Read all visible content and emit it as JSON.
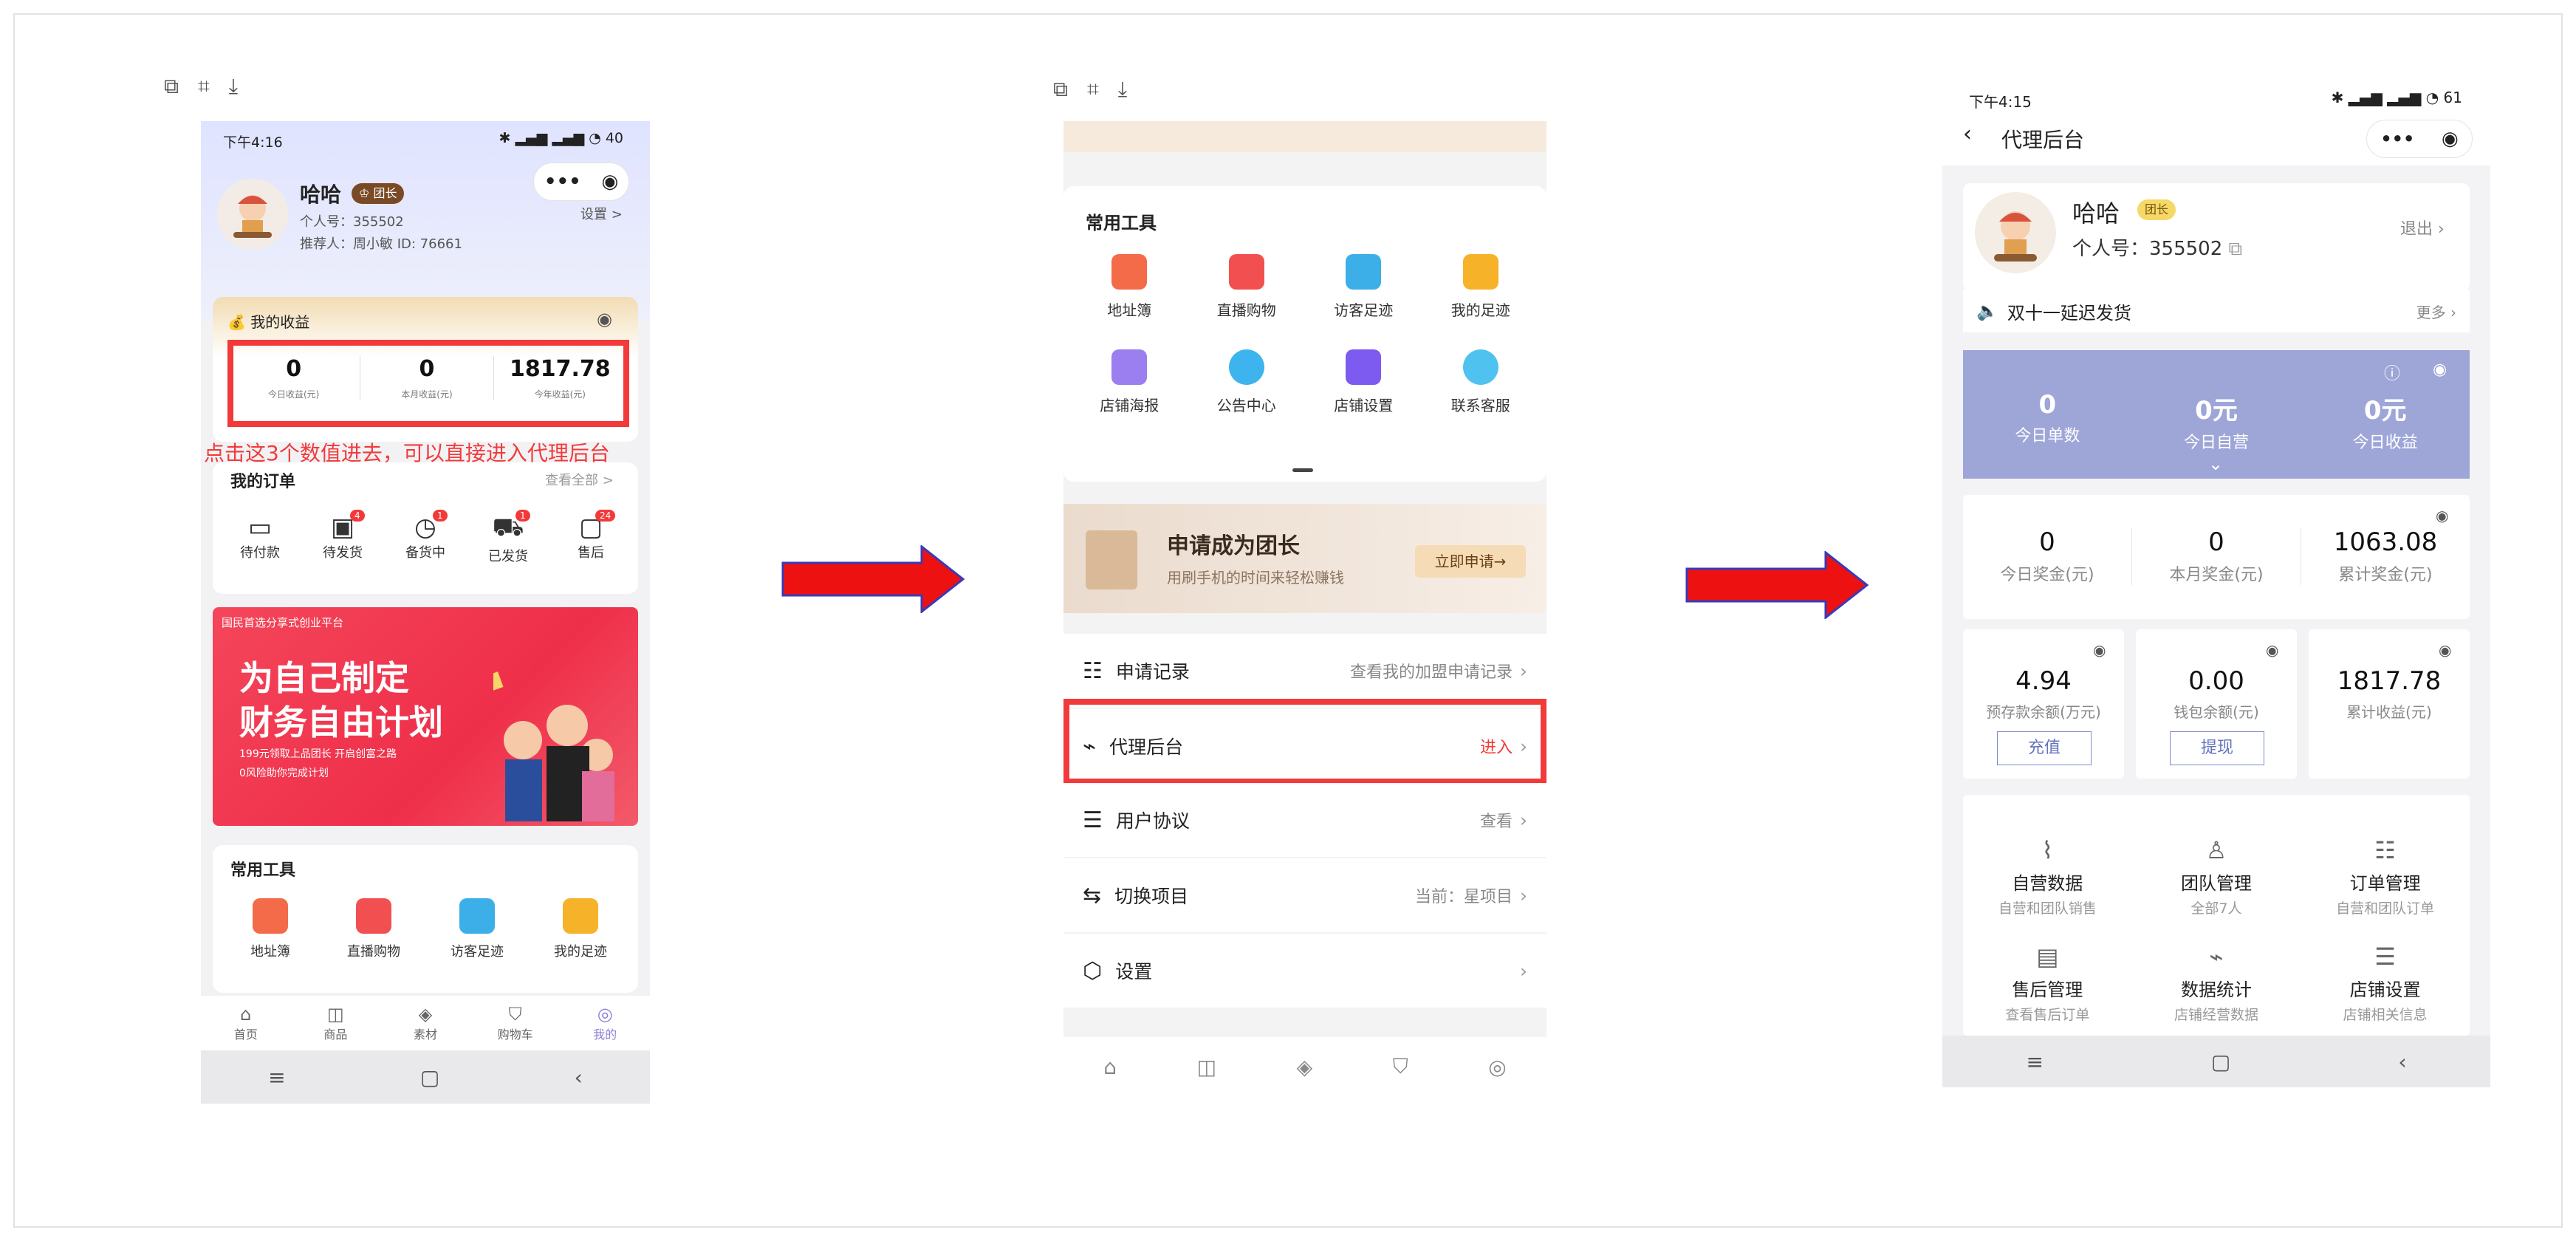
{
  "screen1": {
    "status_time": "下午4:16",
    "status_battery": "40",
    "user_name": "哈哈",
    "role_badge": "团长",
    "personal_id": "个人号：355502",
    "referrer": "推荐人：周小敏  ID: 76661",
    "settings_label": "设置 >",
    "earnings_title": "我的收益",
    "earnings": [
      {
        "value": "0",
        "label": "今日收益(元)"
      },
      {
        "value": "0",
        "label": "本月收益(元)"
      },
      {
        "value": "1817.78",
        "label": "今年收益(元)"
      }
    ],
    "annotation": "点击这3个数值进去，可以直接进入代理后台",
    "orders_title": "我的订单",
    "orders_view_all": "查看全部 >",
    "order_items": [
      {
        "label": "待付款",
        "badge": ""
      },
      {
        "label": "待发货",
        "badge": "4"
      },
      {
        "label": "备货中",
        "badge": "1"
      },
      {
        "label": "已发货",
        "badge": "1"
      },
      {
        "label": "售后",
        "badge": "24"
      }
    ],
    "banner_top": "国民首选分享式创业平台",
    "banner_line1": "为自己制定",
    "banner_line2": "财务自由计划",
    "banner_sub1": "199元领取上品团长 开启创富之路",
    "banner_sub2": "0风险助你完成计划",
    "tools_title": "常用工具",
    "tools": [
      "地址簿",
      "直播购物",
      "访客足迹",
      "我的足迹"
    ],
    "tabbar": [
      "首页",
      "商品",
      "素材",
      "购物车",
      "我的"
    ]
  },
  "screen2": {
    "tools_title": "常用工具",
    "tools": [
      "地址簿",
      "直播购物",
      "访客足迹",
      "我的足迹",
      "店铺海报",
      "公告中心",
      "店铺设置",
      "联系客服"
    ],
    "apply_title": "申请成为团长",
    "apply_sub": "用刷手机的时间来轻松赚钱",
    "apply_button": "立即申请→",
    "menu": [
      {
        "label": "申请记录",
        "right": "查看我的加盟申请记录"
      },
      {
        "label": "代理后台",
        "right": "进入"
      },
      {
        "label": "用户协议",
        "right": "查看"
      },
      {
        "label": "切换项目",
        "right": "当前：星项目"
      },
      {
        "label": "设置",
        "right": ""
      }
    ]
  },
  "screen3": {
    "status_time": "下午4:15",
    "status_battery": "61",
    "page_title": "代理后台",
    "user_name": "哈哈",
    "role_badge": "团长",
    "personal_id": "个人号：355502",
    "logout": "退出",
    "notice": "双十一延迟发货",
    "notice_more": "更多",
    "today_stats": [
      {
        "value": "0",
        "label": "今日单数"
      },
      {
        "value": "0元",
        "label": "今日自营"
      },
      {
        "value": "0元",
        "label": "今日收益"
      }
    ],
    "bonus_stats": [
      {
        "value": "0",
        "label": "今日奖金(元)"
      },
      {
        "value": "0",
        "label": "本月奖金(元)"
      },
      {
        "value": "1063.08",
        "label": "累计奖金(元)"
      }
    ],
    "balance_stats": [
      {
        "value": "4.94",
        "label": "预存款余额(万元)",
        "button": "充值"
      },
      {
        "value": "0.00",
        "label": "钱包余额(元)",
        "button": "提现"
      },
      {
        "value": "1817.78",
        "label": "累计收益(元)",
        "button": ""
      }
    ],
    "functions": [
      {
        "title": "自营数据",
        "sub": "自营和团队销售"
      },
      {
        "title": "团队管理",
        "sub": "全部7人"
      },
      {
        "title": "订单管理",
        "sub": "自营和团队订单"
      },
      {
        "title": "售后管理",
        "sub": "查看售后订单"
      },
      {
        "title": "数据统计",
        "sub": "店铺经营数据"
      },
      {
        "title": "店铺设置",
        "sub": "店铺相关信息"
      }
    ]
  },
  "colors": {
    "highlight_red": "#f23a3a",
    "arrow_red": "#ee1111",
    "panel_purple": "#9ea6d8",
    "badge_brown": "#7a4a26",
    "badge_yellow": "#f6d866"
  }
}
